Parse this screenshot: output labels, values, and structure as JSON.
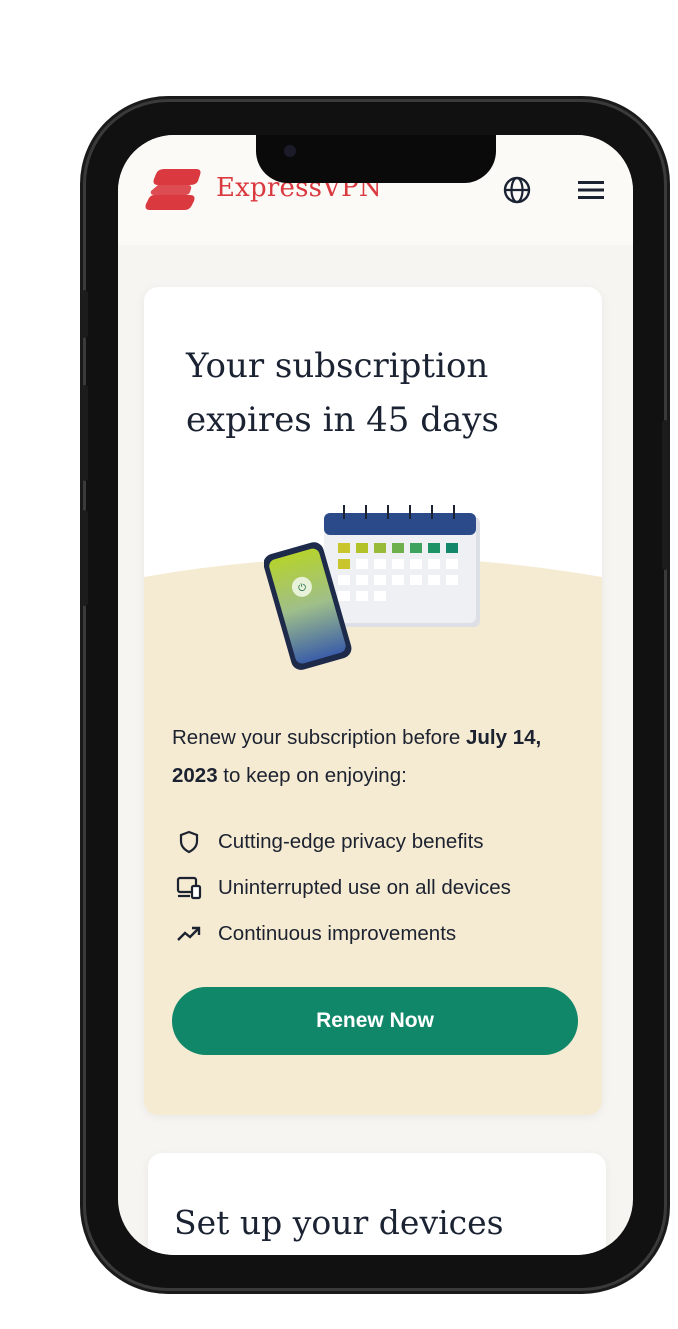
{
  "header": {
    "brand": "ExpressVPN",
    "icons": {
      "language": "globe-icon",
      "menu": "hamburger-menu-icon"
    },
    "brand_color": "#da3940"
  },
  "subscription_card": {
    "title_line1": "Your subscription",
    "title_line2": "expires in 45 days",
    "intro_prefix": "Renew your subscription before ",
    "renew_date": "July 14, 2023",
    "intro_suffix": " to keep on enjoying:",
    "benefits": [
      {
        "icon": "shield-icon",
        "label": "Cutting-edge privacy benefits"
      },
      {
        "icon": "devices-icon",
        "label": "Uninterrupted use on all devices"
      },
      {
        "icon": "trend-up-icon",
        "label": "Continuous improvements"
      }
    ],
    "renew_button": "Renew Now",
    "button_color": "#0f8768",
    "panel_color": "#f5ebd2"
  },
  "setup_card": {
    "title": "Set up your devices"
  }
}
